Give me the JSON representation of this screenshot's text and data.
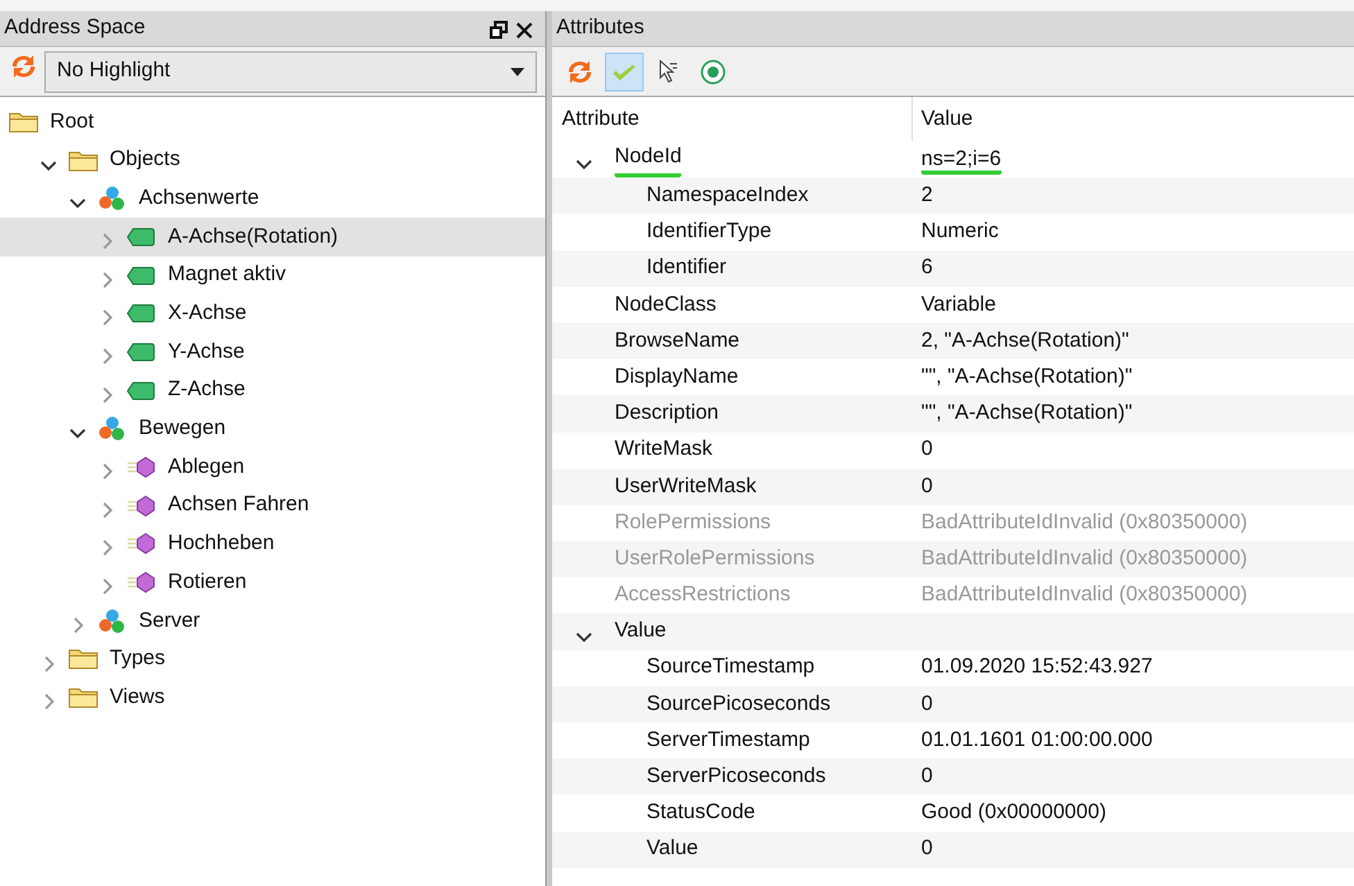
{
  "address_space": {
    "title": "Address Space",
    "highlight_select": {
      "value": "No Highlight"
    },
    "tree": [
      {
        "label": "Root",
        "kind": "folder",
        "selected": false,
        "children": [
          {
            "label": "Objects",
            "kind": "folder",
            "selected": false,
            "expanded": true,
            "children": [
              {
                "label": "Achsenwerte",
                "kind": "object",
                "selected": false,
                "expanded": true,
                "children": [
                  {
                    "label": "A-Achse(Rotation)",
                    "kind": "variable",
                    "selected": true,
                    "expanded": false
                  },
                  {
                    "label": "Magnet aktiv",
                    "kind": "variable",
                    "selected": false,
                    "expanded": false
                  },
                  {
                    "label": "X-Achse",
                    "kind": "variable",
                    "selected": false,
                    "expanded": false
                  },
                  {
                    "label": "Y-Achse",
                    "kind": "variable",
                    "selected": false,
                    "expanded": false
                  },
                  {
                    "label": "Z-Achse",
                    "kind": "variable",
                    "selected": false,
                    "expanded": false
                  }
                ]
              },
              {
                "label": "Bewegen",
                "kind": "object",
                "selected": false,
                "expanded": true,
                "children": [
                  {
                    "label": "Ablegen",
                    "kind": "method",
                    "selected": false,
                    "expanded": false
                  },
                  {
                    "label": "Achsen Fahren",
                    "kind": "method",
                    "selected": false,
                    "expanded": false
                  },
                  {
                    "label": "Hochheben",
                    "kind": "method",
                    "selected": false,
                    "expanded": false
                  },
                  {
                    "label": "Rotieren",
                    "kind": "method",
                    "selected": false,
                    "expanded": false
                  }
                ]
              },
              {
                "label": "Server",
                "kind": "object",
                "selected": false,
                "expanded": false
              }
            ]
          },
          {
            "label": "Types",
            "kind": "folder",
            "selected": false,
            "expanded": false
          },
          {
            "label": "Views",
            "kind": "folder",
            "selected": false,
            "expanded": false
          }
        ]
      }
    ]
  },
  "attributes": {
    "title": "Attributes",
    "toolbar": [
      {
        "kind": "refresh",
        "pressed": false
      },
      {
        "kind": "check",
        "pressed": true
      },
      {
        "kind": "pointer",
        "pressed": false
      },
      {
        "kind": "target",
        "pressed": false
      }
    ],
    "columns": [
      "Attribute",
      "Value"
    ],
    "rows": [
      {
        "name": "NodeId",
        "value": "ns=2;i=6",
        "expanded": true,
        "underlined": true,
        "disabled": false,
        "children": [
          {
            "name": "NamespaceIndex",
            "value": "2",
            "disabled": false
          },
          {
            "name": "IdentifierType",
            "value": "Numeric",
            "disabled": false
          },
          {
            "name": "Identifier",
            "value": "6",
            "disabled": false
          }
        ]
      },
      {
        "name": "NodeClass",
        "value": "Variable",
        "disabled": false
      },
      {
        "name": "BrowseName",
        "value": "2, \"A-Achse(Rotation)\"",
        "disabled": false
      },
      {
        "name": "DisplayName",
        "value": "\"\", \"A-Achse(Rotation)\"",
        "disabled": false
      },
      {
        "name": "Description",
        "value": "\"\", \"A-Achse(Rotation)\"",
        "disabled": false
      },
      {
        "name": "WriteMask",
        "value": "0",
        "disabled": false
      },
      {
        "name": "UserWriteMask",
        "value": "0",
        "disabled": false
      },
      {
        "name": "RolePermissions",
        "value": "BadAttributeIdInvalid (0x80350000)",
        "disabled": true
      },
      {
        "name": "UserRolePermissions",
        "value": "BadAttributeIdInvalid (0x80350000)",
        "disabled": true
      },
      {
        "name": "AccessRestrictions",
        "value": "BadAttributeIdInvalid (0x80350000)",
        "disabled": true
      },
      {
        "name": "Value",
        "expanded": true,
        "disabled": false,
        "children": [
          {
            "name": "SourceTimestamp",
            "value": "01.09.2020 15:52:43.927",
            "disabled": false
          },
          {
            "name": "SourcePicoseconds",
            "value": "0",
            "disabled": false
          },
          {
            "name": "ServerTimestamp",
            "value": "01.01.1601 01:00:00.000",
            "disabled": false
          },
          {
            "name": "ServerPicoseconds",
            "value": "0",
            "disabled": false
          },
          {
            "name": "StatusCode",
            "value": "Good (0x00000000)",
            "disabled": false
          },
          {
            "name": "Value",
            "value": "0",
            "disabled": false
          }
        ]
      }
    ]
  }
}
